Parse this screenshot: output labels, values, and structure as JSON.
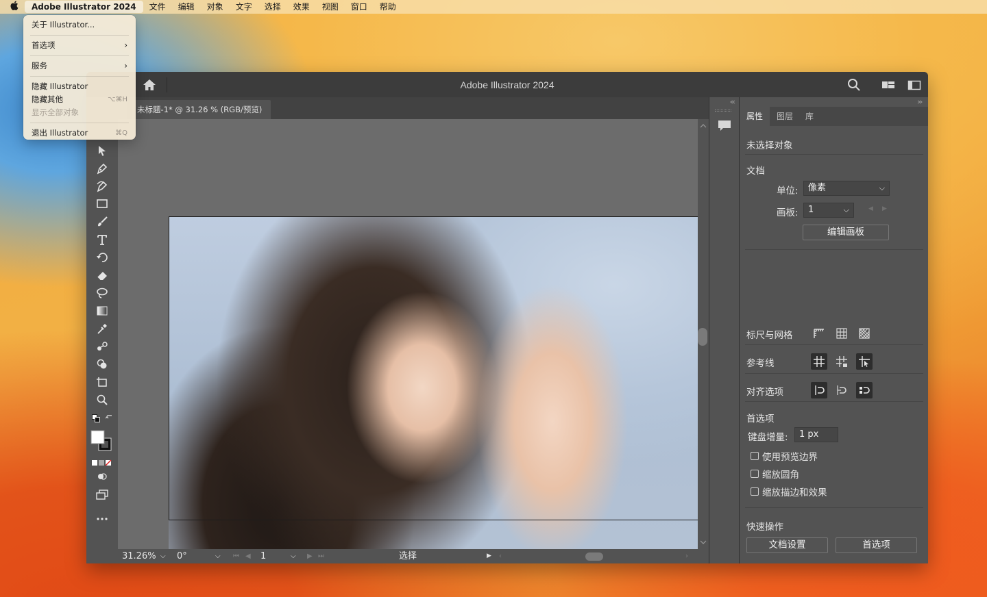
{
  "menubar": {
    "app_name": "Adobe Illustrator 2024",
    "items": [
      "文件",
      "编辑",
      "对象",
      "文字",
      "选择",
      "效果",
      "视图",
      "窗口",
      "帮助"
    ]
  },
  "app_menu": {
    "about": "关于 Illustrator...",
    "preferences": "首选项",
    "services": "服务",
    "hide": "隐藏 Illustrator",
    "hide_others": "隐藏其他",
    "hide_others_shortcut": "⌥⌘H",
    "show_all": "显示全部对象",
    "quit": "退出 Illustrator",
    "quit_shortcut": "⌘Q"
  },
  "window": {
    "title": "Adobe Illustrator 2024",
    "doc_tab": "未标题-1* @ 31.26 % (RGB/预览)"
  },
  "statusbar": {
    "zoom": "31.26%",
    "rotation": "0°",
    "artboard": "1",
    "tool": "选择"
  },
  "panel": {
    "tabs": [
      "属性",
      "图层",
      "库"
    ],
    "no_selection": "未选择对象",
    "document_label": "文档",
    "unit_label": "单位:",
    "unit_value": "像素",
    "artboard_label": "画板:",
    "artboard_value": "1",
    "edit_artboard": "编辑画板",
    "rulers_grids": "标尺与网格",
    "guides": "参考线",
    "align_options": "对齐选项",
    "preferences_label": "首选项",
    "keyboard_increment_label": "键盘增量:",
    "keyboard_increment_value": "1 px",
    "use_preview_bounds": "使用预览边界",
    "scale_corners": "缩放圆角",
    "scale_strokes": "缩放描边和效果",
    "quick_actions": "快速操作",
    "doc_setup": "文档设置",
    "preferences_button": "首选项"
  },
  "colors": {
    "fill": "#ffffff",
    "stroke": "#000000",
    "ui_dark": "#535353"
  }
}
